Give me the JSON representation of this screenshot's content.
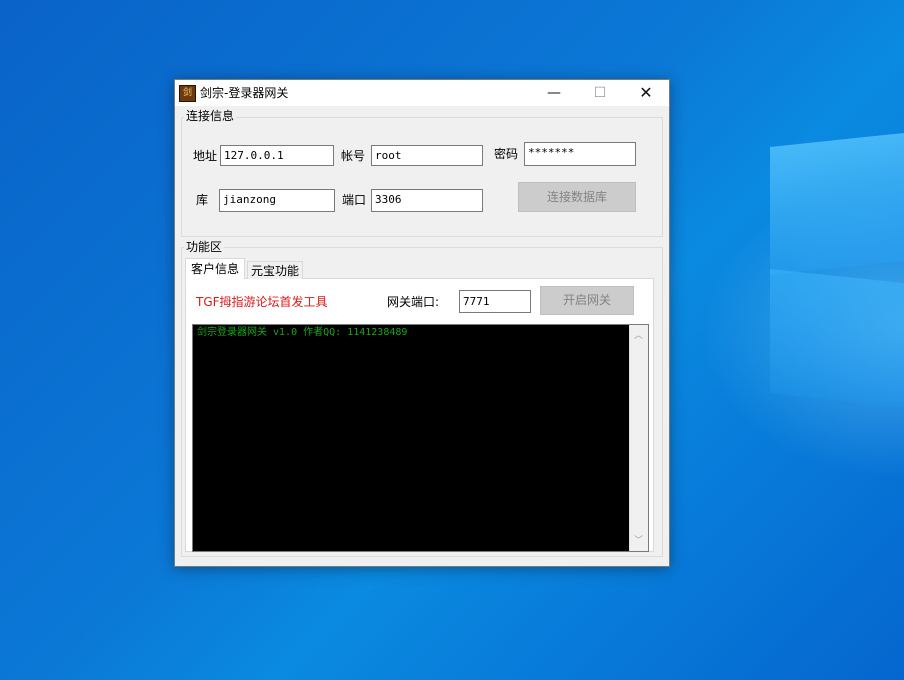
{
  "window": {
    "title": "剑宗-登录器网关",
    "icon_text": "剑"
  },
  "titlebar": {
    "minimize": "—",
    "maximize": "☐",
    "close": "✕"
  },
  "connection": {
    "group_label": "连接信息",
    "address_label": "地址",
    "address_value": "127.0.0.1",
    "account_label": "帐号",
    "account_value": "root",
    "password_label": "密码",
    "password_value": "*******",
    "db_label": "库",
    "db_value": "jianzong",
    "port_label": "端口",
    "port_value": "3306",
    "connect_button": "连接数据库"
  },
  "functions": {
    "group_label": "功能区",
    "tabs": [
      {
        "label": "客户信息"
      },
      {
        "label": "元宝功能"
      }
    ],
    "promo_text": "TGF拇指游论坛首发工具",
    "gateway_port_label": "网关端口:",
    "gateway_port_value": "7771",
    "start_button": "开启网关",
    "console_line": "剑宗登录器网关 v1.0 作者QQ: 1141238489"
  }
}
